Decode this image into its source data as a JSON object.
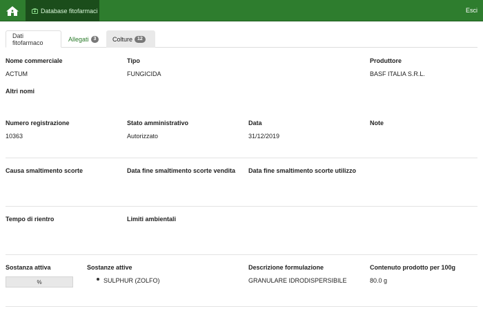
{
  "nav": {
    "active_label": "Database fitofarmaci",
    "exit_label": "Esci"
  },
  "tabs": [
    {
      "label": "Dati fitofarmaco"
    },
    {
      "label": "Allegati",
      "badge": "3"
    },
    {
      "label": "Colture",
      "badge": "12"
    }
  ],
  "fields": {
    "nome_commerciale": {
      "label": "Nome commerciale",
      "value": "ACTUM"
    },
    "tipo": {
      "label": "Tipo",
      "value": "FUNGICIDA"
    },
    "produttore": {
      "label": "Produttore",
      "value": "BASF ITALIA S.R.L."
    },
    "altri_nomi": {
      "label": "Altri nomi",
      "value": ""
    },
    "numero_registrazione": {
      "label": "Numero registrazione",
      "value": "10363"
    },
    "stato_amministrativo": {
      "label": "Stato amministrativo",
      "value": "Autorizzato"
    },
    "data": {
      "label": "Data",
      "value": "31/12/2019"
    },
    "note": {
      "label": "Note",
      "value": ""
    },
    "causa_smaltimento": {
      "label": "Causa smaltimento scorte",
      "value": ""
    },
    "data_fine_vendita": {
      "label": "Data fine smaltimento scorte vendita",
      "value": ""
    },
    "data_fine_utilizzo": {
      "label": "Data fine smaltimento scorte utilizzo",
      "value": ""
    },
    "tempo_rientro": {
      "label": "Tempo di rientro",
      "value": ""
    },
    "limiti_ambientali": {
      "label": "Limiti ambientali",
      "value": ""
    },
    "sostanza_attiva": {
      "label": "Sostanza attiva",
      "value": "%"
    },
    "sostanze_attive": {
      "label": "Sostanze attive",
      "items": [
        "SULPHUR (ZOLFO)"
      ]
    },
    "descrizione_formulazione": {
      "label": "Descrizione formulazione",
      "value": "GRANULARE IDRODISPERSIBILE"
    },
    "contenuto_prodotto": {
      "label": "Contenuto prodotto per 100g",
      "value": "80.0 g"
    }
  },
  "colors": {
    "nav_bg": "#2e7d2e",
    "nav_active_bg": "#1b4d1b",
    "link_green": "#2a7a2a",
    "badge_bg": "#777777"
  },
  "icons": {
    "home": "home-icon",
    "database": "medkit-icon"
  }
}
